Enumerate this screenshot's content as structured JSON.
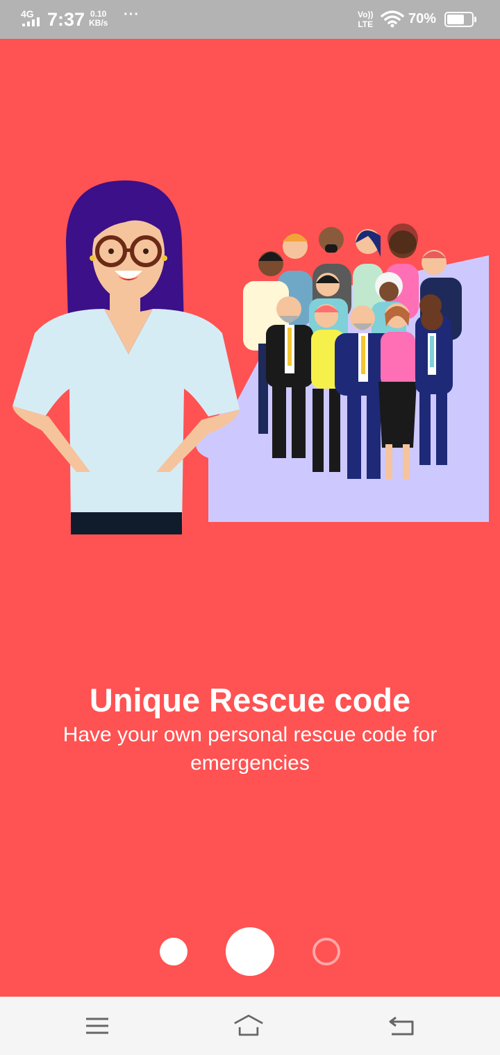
{
  "status_bar": {
    "network": "4G",
    "time": "7:37",
    "speed_value": "0.10",
    "speed_unit": "KB/s",
    "overflow": "···",
    "volte_top": "Vo))",
    "volte_bottom": "LTE",
    "battery_percent": "70%",
    "battery_level": 0.7
  },
  "onboarding": {
    "title": "Unique Rescue code",
    "subtitle": "Have your own personal rescue code for emergencies",
    "page_count": 3,
    "current_page": 2
  },
  "colors": {
    "background": "#ff5252",
    "status_bar": "#b3b3b3",
    "accent_panel": "#cdc9ff",
    "nav_bar": "#f5f5f5"
  },
  "nav_bar": {
    "icons": [
      "menu-icon",
      "home-icon",
      "back-icon"
    ]
  }
}
